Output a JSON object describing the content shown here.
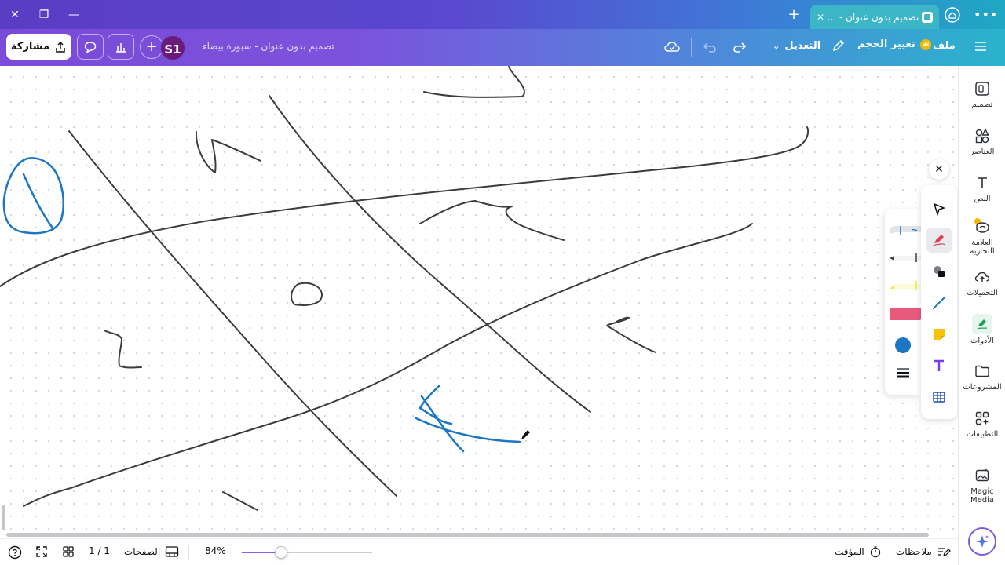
{
  "browser": {
    "tab_title": "تصميم بدون عنوان - ...",
    "window_controls": [
      "close-icon",
      "restore-icon",
      "minimize-icon"
    ]
  },
  "header": {
    "share_label": "مشاركة",
    "avatar_initials": "S1",
    "doc_title": "تصميم بدون عنوان - سبورة بيضاء",
    "edit_label": "التعديل",
    "resize_label": "تغيير الحجم",
    "file_label": "ملف",
    "colors": {
      "brand_start": "#7a4bd8",
      "brand_end": "#2ab3cc",
      "avatar_bg": "#6a1b7a"
    }
  },
  "sidebar": {
    "items": [
      {
        "label": "تصميم",
        "icon": "design-icon"
      },
      {
        "label": "العناصر",
        "icon": "elements-icon"
      },
      {
        "label": "النص",
        "icon": "text-icon"
      },
      {
        "label": "العلامة التجارية",
        "icon": "brand-icon"
      },
      {
        "label": "التحميلات",
        "icon": "upload-cloud-icon"
      },
      {
        "label": "الأدوات",
        "icon": "draw-tools-icon"
      },
      {
        "label": "المشروعات",
        "icon": "folder-icon"
      },
      {
        "label": "التطبيقات",
        "icon": "apps-icon"
      },
      {
        "label": "Magic Media",
        "icon": "magic-media-icon"
      }
    ]
  },
  "draw_tools": {
    "tools": [
      "select-arrow-icon",
      "pen-icon",
      "shapes-icon",
      "line-icon",
      "sticky-note-icon",
      "text-tool-icon",
      "table-icon"
    ],
    "active_tool": "pen-icon",
    "pens": [
      "blue-pen",
      "black-marker",
      "yellow-highlighter",
      "eraser"
    ],
    "selected_color": "#1b76c4"
  },
  "footer": {
    "notes_label": "ملاحظات",
    "timer_label": "المؤقت",
    "zoom_value": 0.3,
    "zoom_label": "84%",
    "pages_label": "الصفحات",
    "page_counter": "1 / 1"
  }
}
